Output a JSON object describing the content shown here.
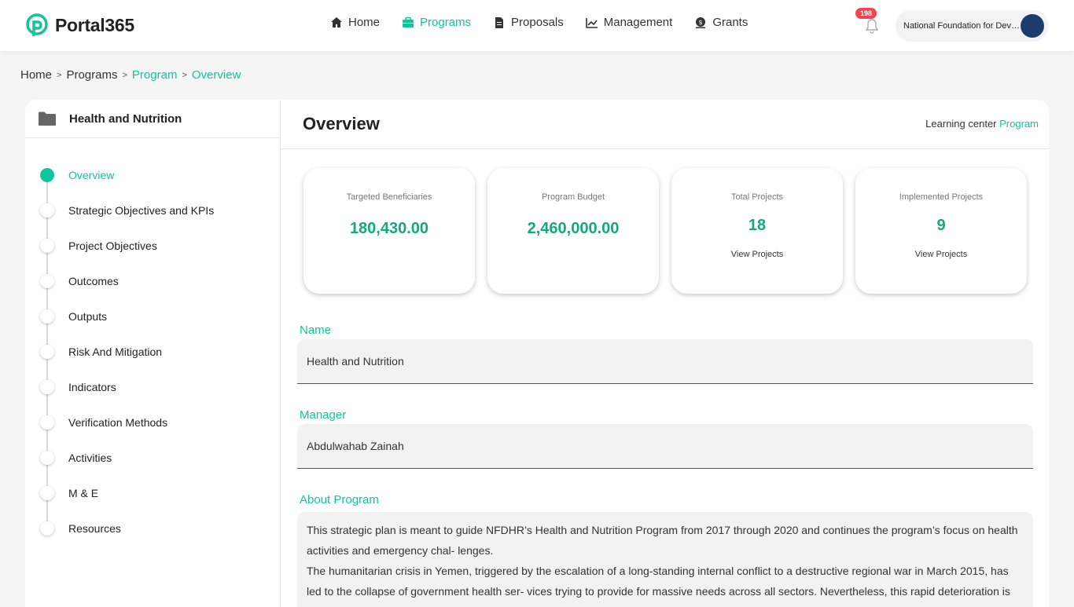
{
  "brand": {
    "name": "Portal365"
  },
  "nav": {
    "items": [
      {
        "label": "Home",
        "icon": "home-icon",
        "active": false
      },
      {
        "label": "Programs",
        "icon": "briefcase-icon",
        "active": true
      },
      {
        "label": "Proposals",
        "icon": "document-icon",
        "active": false
      },
      {
        "label": "Management",
        "icon": "chart-line-icon",
        "active": false
      },
      {
        "label": "Grants",
        "icon": "money-icon",
        "active": false
      }
    ],
    "notifications_count": "198",
    "org_name": "National Foundation for Development and Humanitarian Response"
  },
  "breadcrumb": [
    "Home",
    "Programs",
    "Program",
    "Overview"
  ],
  "program": {
    "title": "Health and Nutrition"
  },
  "steps": [
    "Overview",
    "Strategic Objectives and KPIs",
    "Project Objectives",
    "Outcomes",
    "Outputs",
    "Risk And Mitigation",
    "Indicators",
    "Verification Methods",
    "Activities",
    "M & E",
    "Resources"
  ],
  "main": {
    "title": "Overview",
    "learning_center": "Learning center",
    "learning_center_link": "Program",
    "cards": [
      {
        "label": "Targeted Beneficiaries",
        "value": "180,430.00",
        "link": ""
      },
      {
        "label": "Program Budget",
        "value": "2,460,000.00",
        "link": ""
      },
      {
        "label": "Total Projects",
        "value": "18",
        "link": "View Projects"
      },
      {
        "label": "Implemented Projects",
        "value": "9",
        "link": "View Projects"
      }
    ],
    "name_label": "Name",
    "name_value": "Health and Nutrition",
    "manager_label": "Manager",
    "manager_value": "Abdulwahab Zainah",
    "about_label": "About Program",
    "about_p1": "This strategic plan is meant to guide NFDHR’s Health and Nutrition Program from 2017 through 2020 and continues the program’s focus on health activities and emergency chal- lenges.",
    "about_p2": "The humanitarian crisis in Yemen, triggered by the escalation of a long-standing internal conflict to a destructive regional war in March 2015, has led to the collapse of government health ser- vices trying to provide for massive needs across all sectors. Nevertheless, this rapid deterioration is"
  },
  "colors": {
    "accent": "#15c39a",
    "badge": "#f0464f"
  }
}
